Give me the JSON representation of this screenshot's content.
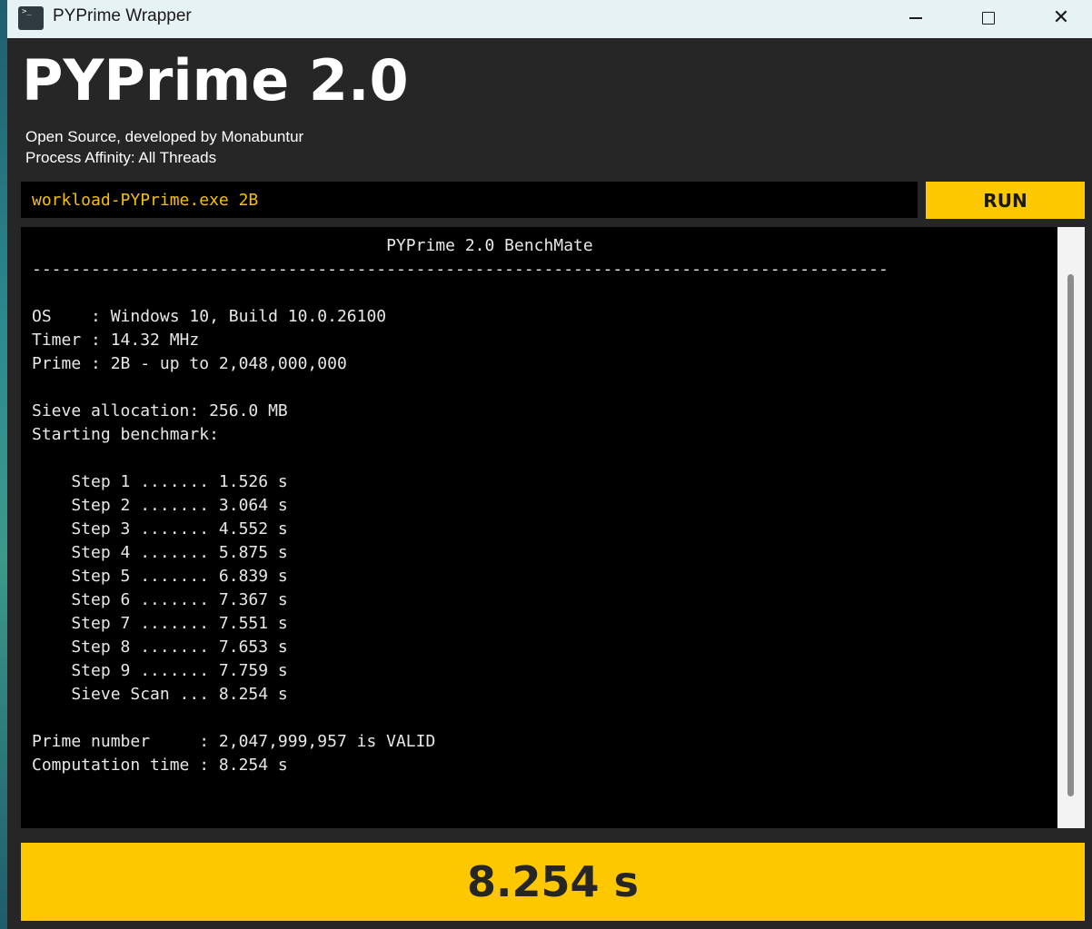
{
  "window": {
    "title": "PYPrime Wrapper",
    "app_icon": "terminal-icon",
    "controls": {
      "minimize": "minimize-icon",
      "maximize": "maximize-icon",
      "close": "close-icon"
    }
  },
  "header": {
    "title": "PYPrime 2.0",
    "subtitle_line1": "Open Source, developed by Monabuntur",
    "subtitle_line2": "Process Affinity: All Threads"
  },
  "command": {
    "value": "workload-PYPrime.exe 2B",
    "run_label": "RUN"
  },
  "console": {
    "lines": [
      "                                    PYPrime 2.0 BenchMate",
      "---------------------------------------------------------------------------------------",
      "",
      "OS    : Windows 10, Build 10.0.26100",
      "Timer : 14.32 MHz",
      "Prime : 2B - up to 2,048,000,000",
      "",
      "Sieve allocation: 256.0 MB",
      "Starting benchmark:",
      "",
      "    Step 1 ....... 1.526 s",
      "    Step 2 ....... 3.064 s",
      "    Step 3 ....... 4.552 s",
      "    Step 4 ....... 5.875 s",
      "    Step 5 ....... 6.839 s",
      "    Step 6 ....... 7.367 s",
      "    Step 7 ....... 7.551 s",
      "    Step 8 ....... 7.653 s",
      "    Step 9 ....... 7.759 s",
      "    Sieve Scan ... 8.254 s",
      "",
      "Prime number     : 2,047,999,957 is VALID",
      "Computation time : 8.254 s"
    ]
  },
  "result": {
    "value": "8.254 s"
  },
  "colors": {
    "accent": "#fdc800",
    "input_text": "#f5c000",
    "background": "#262626",
    "console_bg": "#000000"
  }
}
